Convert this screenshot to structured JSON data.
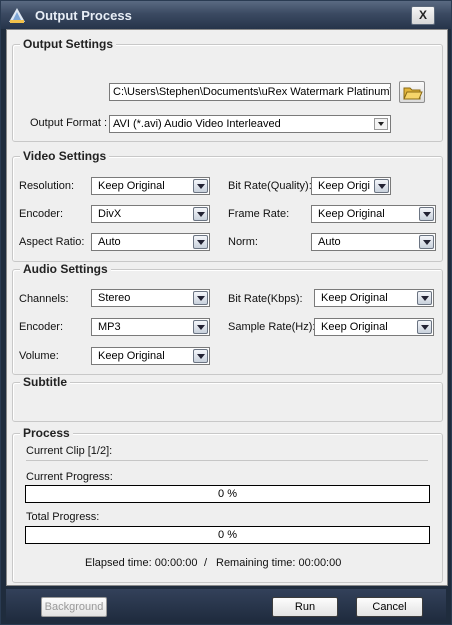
{
  "window": {
    "title": "Output Process",
    "close_glyph": "X"
  },
  "output_settings": {
    "group_title": "Output Settings",
    "path_value": "C:\\Users\\Stephen\\Documents\\uRex Watermark Platinum\\",
    "format_label": "Output Format :",
    "format_value": "AVI  (*.avi) Audio Video Interleaved"
  },
  "video_settings": {
    "group_title": "Video Settings",
    "resolution_label": "Resolution:",
    "resolution_value": "Keep Original",
    "encoder_label": "Encoder:",
    "encoder_value": "DivX",
    "aspect_label": "Aspect Ratio:",
    "aspect_value": "Auto",
    "bitrate_label": "Bit Rate(Quality):",
    "bitrate_value": "Keep Origi",
    "framerate_label": "Frame Rate:",
    "framerate_value": "Keep Original",
    "norm_label": "Norm:",
    "norm_value": "Auto"
  },
  "audio_settings": {
    "group_title": "Audio Settings",
    "channels_label": "Channels:",
    "channels_value": "Stereo",
    "encoder_label": "Encoder:",
    "encoder_value": "MP3",
    "volume_label": "Volume:",
    "volume_value": "Keep Original",
    "bitrate_label": "Bit Rate(Kbps):",
    "bitrate_value": "Keep Original",
    "samplerate_label": "Sample Rate(Hz):",
    "samplerate_value": "Keep Original"
  },
  "subtitle": {
    "group_title": "Subtitle"
  },
  "process": {
    "group_title": "Process",
    "current_clip": "Current Clip [1/2]:",
    "current_progress_label": "Current Progress:",
    "current_progress_text": "0 %",
    "current_progress_fraction": 0,
    "total_progress_label": "Total Progress:",
    "total_progress_text": "0 %",
    "total_progress_fraction": 0,
    "elapsed": "Elapsed time: 00:00:00",
    "divider": "/",
    "remaining": "Remaining time: 00:00:00"
  },
  "footer": {
    "background_label": "Background",
    "run_label": "Run",
    "cancel_label": "Cancel"
  },
  "icons": {
    "app": "app-logo-icon",
    "folder": "folder-open-icon",
    "dropdown": "chevron-down-icon"
  }
}
